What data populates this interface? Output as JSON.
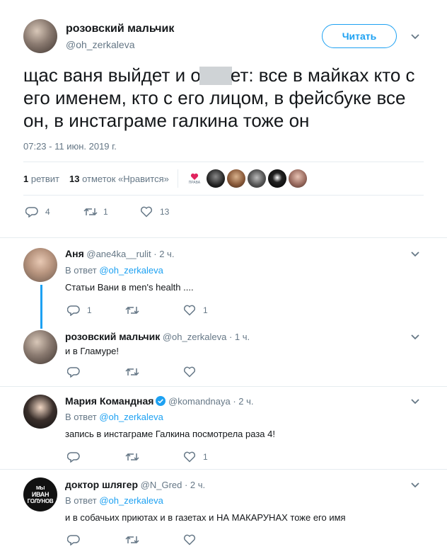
{
  "main_tweet": {
    "author_name": "розовский мальчик",
    "author_handle": "@oh_zerkaleva",
    "follow_label": "Читать",
    "text_before": "щас ваня выйдет и о",
    "text_after": "ет: все в майках кто с его именем, кто с его лицом, в фейсбуке все он, в инстаграме галкина тоже он",
    "timestamp": "07:23 - 11 июн. 2019 г.",
    "retweets_count": "1",
    "retweets_label": "ретвит",
    "likes_count": "13",
    "likes_label": "отметок «Нравится»",
    "liker_badge": "ПРАВА",
    "reply_count": "4",
    "retweet_count": "1",
    "like_count": "13"
  },
  "replies": [
    {
      "name": "Аня",
      "handle": "@ane4ka__rulit",
      "time": "· 2 ч.",
      "reply_to_prefix": "В ответ",
      "reply_to": "@oh_zerkaleva",
      "text": "Статьи Вани в men's health ....",
      "reply_count": "1",
      "retweet_count": "",
      "like_count": "1"
    },
    {
      "name": "розовский мальчик",
      "handle": "@oh_zerkaleva",
      "time": "· 1 ч.",
      "text": "и в Гламуре!",
      "reply_count": "",
      "retweet_count": "",
      "like_count": ""
    },
    {
      "name": "Мария Командная",
      "handle": "@komandnaya",
      "time": "· 2 ч.",
      "reply_to_prefix": "В ответ",
      "reply_to": "@oh_zerkaleva",
      "text": "запись в инстаграме Галкина посмотрела раза 4!",
      "reply_count": "",
      "retweet_count": "",
      "like_count": "1"
    },
    {
      "name": "доктор шлягер",
      "handle": "@N_Gred",
      "time": "· 2 ч.",
      "reply_to_prefix": "В ответ",
      "reply_to": "@oh_zerkaleva",
      "text": "и в собачьих приютах и в газетах и НА МАКАРУНАХ тоже его имя",
      "avatar_text_1": "МЫ",
      "avatar_text_2": "ИВАН",
      "avatar_text_3": "ГОЛУНОВ",
      "reply_count": "",
      "retweet_count": "",
      "like_count": ""
    }
  ],
  "colors": {
    "accent": "#1da1f2",
    "muted": "#657786",
    "text": "#14171a",
    "border": "#e6ecf0",
    "verified": "#1da1f2"
  }
}
